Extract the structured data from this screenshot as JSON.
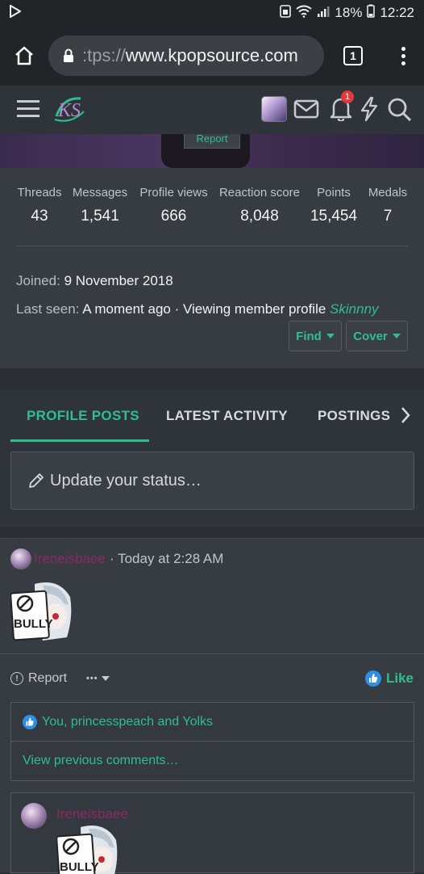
{
  "status_bar": {
    "battery": "18%",
    "time": "12:22"
  },
  "browser": {
    "url_scheme": ":tps://",
    "url_host": "www.kpopsource.com",
    "tab_count": "1"
  },
  "site": {
    "logo_text": "KS",
    "notification_count": "1"
  },
  "banner": {
    "report_label": "Report"
  },
  "stats": [
    {
      "label": "Threads",
      "value": "43"
    },
    {
      "label": "Messages",
      "value": "1,541"
    },
    {
      "label": "Profile views",
      "value": "666"
    },
    {
      "label": "Reaction score",
      "value": "8,048"
    },
    {
      "label": "Points",
      "value": "15,454"
    },
    {
      "label": "Medals",
      "value": "7"
    }
  ],
  "profile": {
    "joined_label": "Joined:",
    "joined_value": "9 November 2018",
    "last_seen_label": "Last seen:",
    "last_seen_value": "A moment ago · Viewing member profile",
    "last_seen_user": "Skinnny",
    "find_label": "Find",
    "cover_label": "Cover"
  },
  "tabs": [
    {
      "label": "PROFILE POSTS",
      "active": true
    },
    {
      "label": "LATEST ACTIVITY",
      "active": false
    },
    {
      "label": "POSTINGS",
      "active": false
    }
  ],
  "status_input": {
    "placeholder": "Update your status…"
  },
  "post": {
    "author": "Ireneisbaee",
    "time": "· Today at 2:28 AM",
    "sticker_text": "BULLY",
    "report_label": "Report",
    "more_label": "•••",
    "like_label": "Like",
    "likes_text": "You, princesspeach and Yolks",
    "view_previous": "View previous comments…"
  },
  "comment": {
    "author": "Ireneisbaee",
    "sticker_text": "BULLY"
  },
  "colors": {
    "accent": "#2fbf8c",
    "author": "#8a2a63",
    "panel": "#373c42"
  }
}
